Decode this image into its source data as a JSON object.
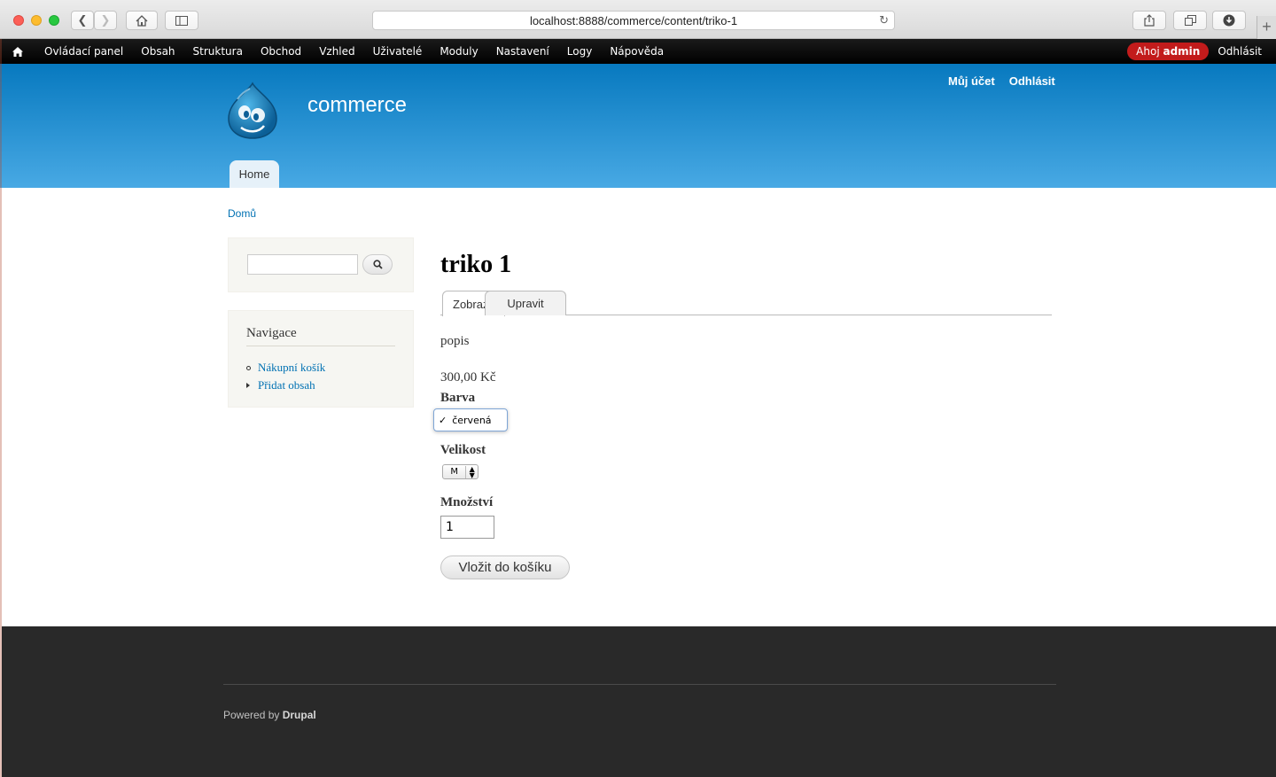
{
  "browser": {
    "url": "localhost:8888/commerce/content/triko-1",
    "colors": {
      "close": "#fc5f57",
      "minimize": "#fdbc2e",
      "zoom": "#28c840"
    }
  },
  "toolbar": {
    "items": [
      "Ovládací panel",
      "Obsah",
      "Struktura",
      "Obchod",
      "Vzhled",
      "Uživatelé",
      "Moduly",
      "Nastavení",
      "Logy",
      "Nápověda"
    ],
    "hello_prefix": "Ahoj",
    "hello_user": "admin",
    "logout": "Odhlásit",
    "hello_color": "#c21b1b"
  },
  "header": {
    "site_name": "commerce",
    "secondary_links": [
      "Můj účet",
      "Odhlásit"
    ],
    "main_tab": "Home",
    "gradient": [
      "#0779bf",
      "#48a9e4"
    ]
  },
  "breadcrumb": "Domů",
  "sidebar": {
    "navigation_title": "Navigace",
    "items": [
      "Nákupní košík",
      "Přidat obsah"
    ]
  },
  "node": {
    "title": "triko 1",
    "tabs": [
      "Zobrazit",
      "Upravit"
    ],
    "description": "popis",
    "price": "300,00 Kč",
    "color_label": "Barva",
    "color_selected": "červená",
    "size_label": "Velikost",
    "size_selected": "M",
    "quantity_label": "Množství",
    "quantity_value": "1",
    "add_to_cart": "Vložit do košíku"
  },
  "footer": {
    "powered_prefix": "Powered by",
    "powered_link": "Drupal"
  }
}
